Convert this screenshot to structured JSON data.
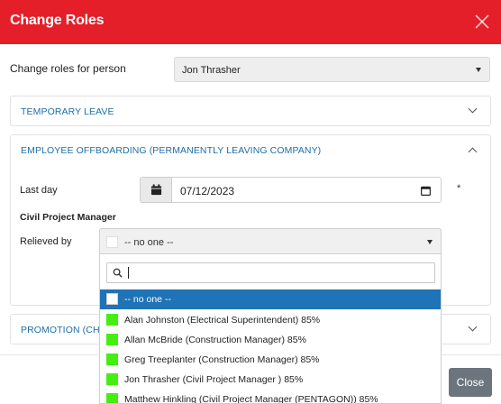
{
  "header": {
    "title": "Change Roles"
  },
  "person": {
    "label": "Change roles for person",
    "selected": "Jon Thrasher"
  },
  "panels": {
    "temporary_leave": "TEMPORARY LEAVE",
    "offboarding": "EMPLOYEE OFFBOARDING (PERMANENTLY LEAVING COMPANY)",
    "promotion": "PROMOTION (CHA"
  },
  "offboarding": {
    "last_day_label": "Last day",
    "last_day_value": "07/12/2023",
    "required_mark": "*",
    "role_title": "Civil Project Manager",
    "relieved_by_label": "Relieved by",
    "relieved_by_value": "-- no one --"
  },
  "dropdown": {
    "search_value": "",
    "options": [
      {
        "label": "-- no one --",
        "swatch": "#ffffff",
        "selected": true
      },
      {
        "label": "Alan Johnston (Electrical Superintendent) 85%",
        "swatch": "#44ee11",
        "selected": false
      },
      {
        "label": "Allan McBride (Construction Manager) 85%",
        "swatch": "#44ee11",
        "selected": false
      },
      {
        "label": "Greg Treeplanter (Construction Manager) 85%",
        "swatch": "#44ee11",
        "selected": false
      },
      {
        "label": "Jon Thrasher (Civil Project Manager ) 85%",
        "swatch": "#44ee11",
        "selected": false
      },
      {
        "label": "Matthew Hinkling (Civil Project Manager (PENTAGON)) 85%",
        "swatch": "#44ee11",
        "selected": false
      }
    ]
  },
  "footer": {
    "close_label": "Close"
  },
  "colors": {
    "header_bg": "#e41f2a",
    "accent": "#1f73b7",
    "match_green": "#44ee11",
    "close_btn": "#6c757d"
  },
  "icons": {
    "close": "close-icon",
    "calendar": "calendar-icon",
    "search": "search-icon"
  }
}
